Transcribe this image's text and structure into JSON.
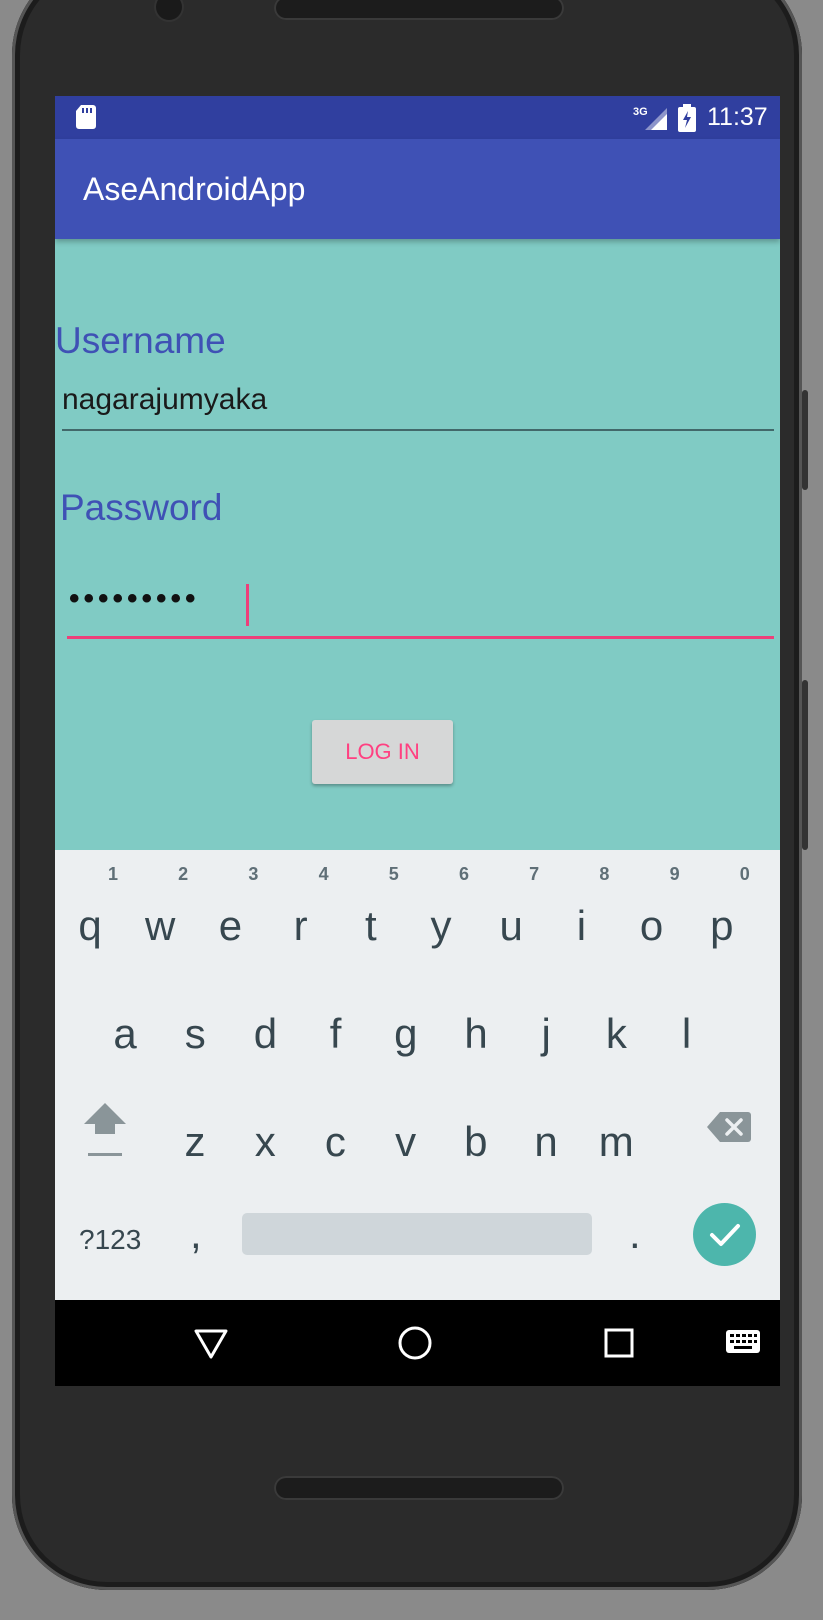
{
  "status_bar": {
    "time": "11:37",
    "network_label": "3G",
    "icons": [
      "sd-card-icon",
      "signal-icon",
      "battery-icon"
    ]
  },
  "app_bar": {
    "title": "AseAndroidApp",
    "color": "#3f51b5"
  },
  "form": {
    "username_label": "Username",
    "username_value": "nagarajumyaka",
    "password_label": "Password",
    "password_masked": "•••••••••",
    "login_label": "LOG IN"
  },
  "keyboard": {
    "row1": [
      {
        "char": "q",
        "num": "1"
      },
      {
        "char": "w",
        "num": "2"
      },
      {
        "char": "e",
        "num": "3"
      },
      {
        "char": "r",
        "num": "4"
      },
      {
        "char": "t",
        "num": "5"
      },
      {
        "char": "y",
        "num": "6"
      },
      {
        "char": "u",
        "num": "7"
      },
      {
        "char": "i",
        "num": "8"
      },
      {
        "char": "o",
        "num": "9"
      },
      {
        "char": "p",
        "num": "0"
      }
    ],
    "row2": [
      "a",
      "s",
      "d",
      "f",
      "g",
      "h",
      "j",
      "k",
      "l"
    ],
    "row3": [
      "z",
      "x",
      "c",
      "v",
      "b",
      "n",
      "m"
    ],
    "symbols_label": "?123",
    "comma": ",",
    "period": "."
  },
  "nav_bar": {
    "icons": [
      "back-icon",
      "home-icon",
      "recents-icon",
      "keyboard-icon"
    ]
  },
  "colors": {
    "status_bar": "#303f9f",
    "background": "#80cbc4",
    "accent": "#ff4081",
    "keyboard": "#eceff1",
    "enter_key": "#4db6ac"
  }
}
